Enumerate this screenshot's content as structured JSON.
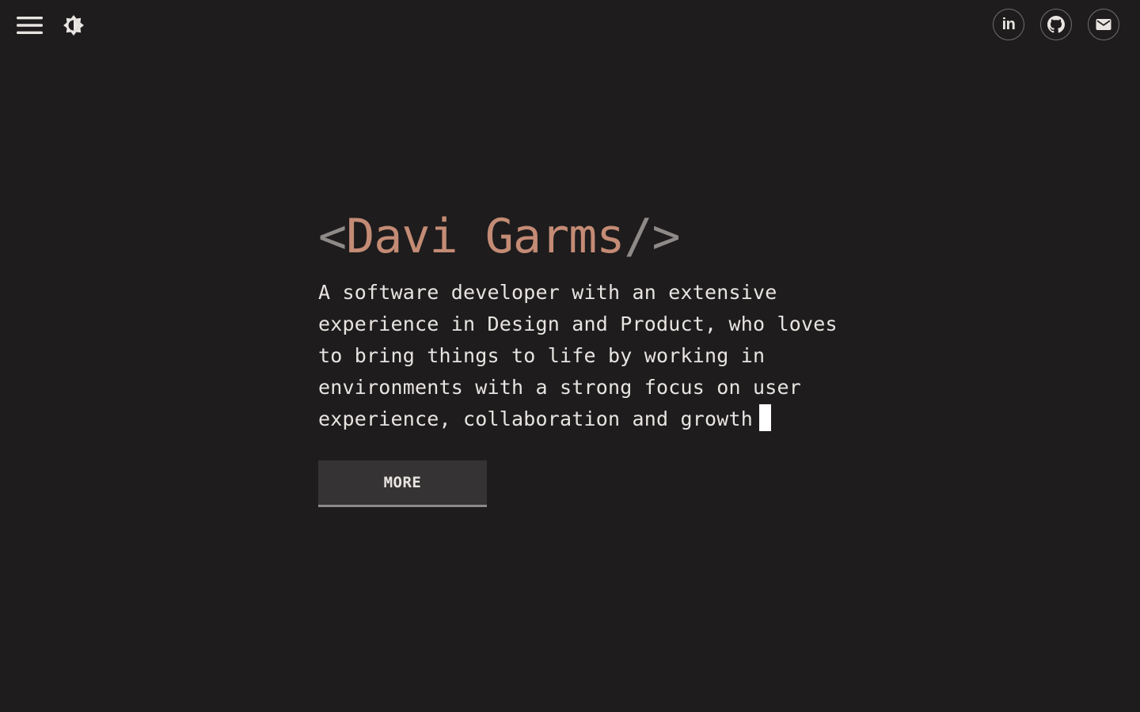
{
  "header": {
    "menu_icon": "hamburger-menu-icon",
    "theme_icon": "brightness-icon",
    "social": [
      {
        "name": "LinkedIn",
        "icon": "linkedin-icon",
        "glyph": "in"
      },
      {
        "name": "GitHub",
        "icon": "github-icon"
      },
      {
        "name": "Email",
        "icon": "email-icon"
      }
    ]
  },
  "hero": {
    "name_open": "<",
    "name": "Davi Garms",
    "name_close": "/>",
    "bio": "A software developer with an extensive experience in Design and Product, who loves to bring things to life by working in environments with a strong focus on user experience, collaboration and growth",
    "more_label": "MORE"
  },
  "colors": {
    "background": "#1e1c1d",
    "accent": "#c48b75",
    "bracket": "#8e8a88",
    "text": "#e7e4e1",
    "button_bg": "#363334"
  }
}
